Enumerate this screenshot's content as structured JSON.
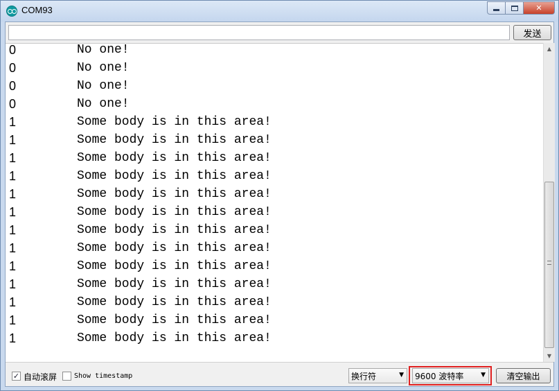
{
  "window": {
    "title": "COM93"
  },
  "titlebar_buttons": {
    "minimize": "minimize-icon",
    "maximize": "maximize-icon",
    "close": "close-icon"
  },
  "send": {
    "input_value": "",
    "button_label": "发送"
  },
  "output": {
    "lines": [
      {
        "value": "0",
        "message": "No one!"
      },
      {
        "value": "0",
        "message": "No one!"
      },
      {
        "value": "0",
        "message": "No one!"
      },
      {
        "value": "0",
        "message": "No one!"
      },
      {
        "value": "1",
        "message": "Some body is in this area!"
      },
      {
        "value": "1",
        "message": "Some body is in this area!"
      },
      {
        "value": "1",
        "message": "Some body is in this area!"
      },
      {
        "value": "1",
        "message": "Some body is in this area!"
      },
      {
        "value": "1",
        "message": "Some body is in this area!"
      },
      {
        "value": "1",
        "message": "Some body is in this area!"
      },
      {
        "value": "1",
        "message": "Some body is in this area!"
      },
      {
        "value": "1",
        "message": "Some body is in this area!"
      },
      {
        "value": "1",
        "message": "Some body is in this area!"
      },
      {
        "value": "1",
        "message": "Some body is in this area!"
      },
      {
        "value": "1",
        "message": "Some body is in this area!"
      },
      {
        "value": "1",
        "message": "Some body is in this area!"
      },
      {
        "value": "1",
        "message": "Some body is in this area!"
      }
    ]
  },
  "bottombar": {
    "autoscroll": {
      "label": "自动滚屏",
      "checked": true
    },
    "timestamp": {
      "label": "Show timestamp",
      "checked": false
    },
    "line_ending": {
      "selected": "换行符"
    },
    "baud": {
      "selected": "9600 波特率"
    },
    "clear_label": "清空输出"
  },
  "colors": {
    "highlight": "#e02020",
    "titlebar": "#c9d9ee"
  }
}
